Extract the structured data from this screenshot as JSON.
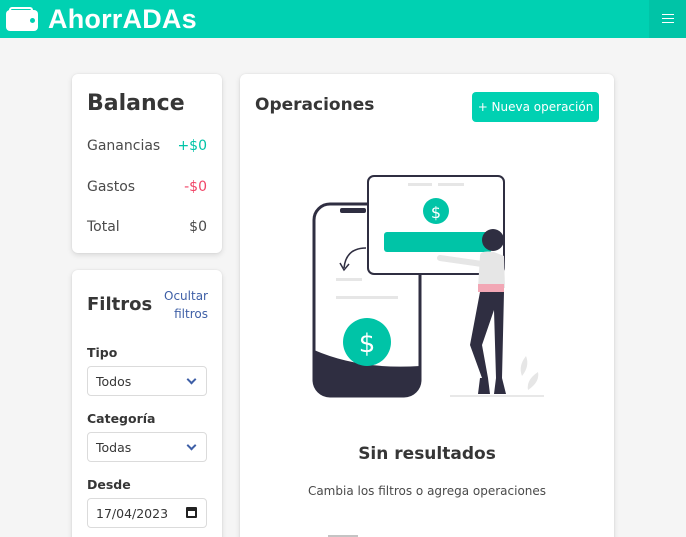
{
  "navbar": {
    "brand": "AhorrADAs",
    "icons": {
      "logo": "wallet-icon",
      "menu": "hamburger-menu-icon"
    },
    "color": "#00d1b2"
  },
  "balance": {
    "title": "Balance",
    "rows": [
      {
        "label": "Ganancias",
        "value": "+$0"
      },
      {
        "label": "Gastos",
        "value": "-$0"
      },
      {
        "label": "Total",
        "value": "$0"
      }
    ]
  },
  "filters": {
    "title": "Filtros",
    "toggle_link": [
      "Ocultar",
      "filtros"
    ],
    "type": {
      "label": "Tipo",
      "selected": "Todos"
    },
    "category": {
      "label": "Categoría",
      "selected": "Todas"
    },
    "from": {
      "label": "Desde",
      "value": "17/04/2023"
    }
  },
  "operations": {
    "title": "Operaciones",
    "new_button": "+ Nueva operación",
    "empty_title": "Sin resultados",
    "empty_hint": "Cambia los filtros o agrega operaciones",
    "illustration_dollar": "$"
  },
  "colors": {
    "accent": "#00d1b2",
    "positive": "#00c4a7",
    "negative": "#f14668",
    "link": "#3e5fa6"
  }
}
